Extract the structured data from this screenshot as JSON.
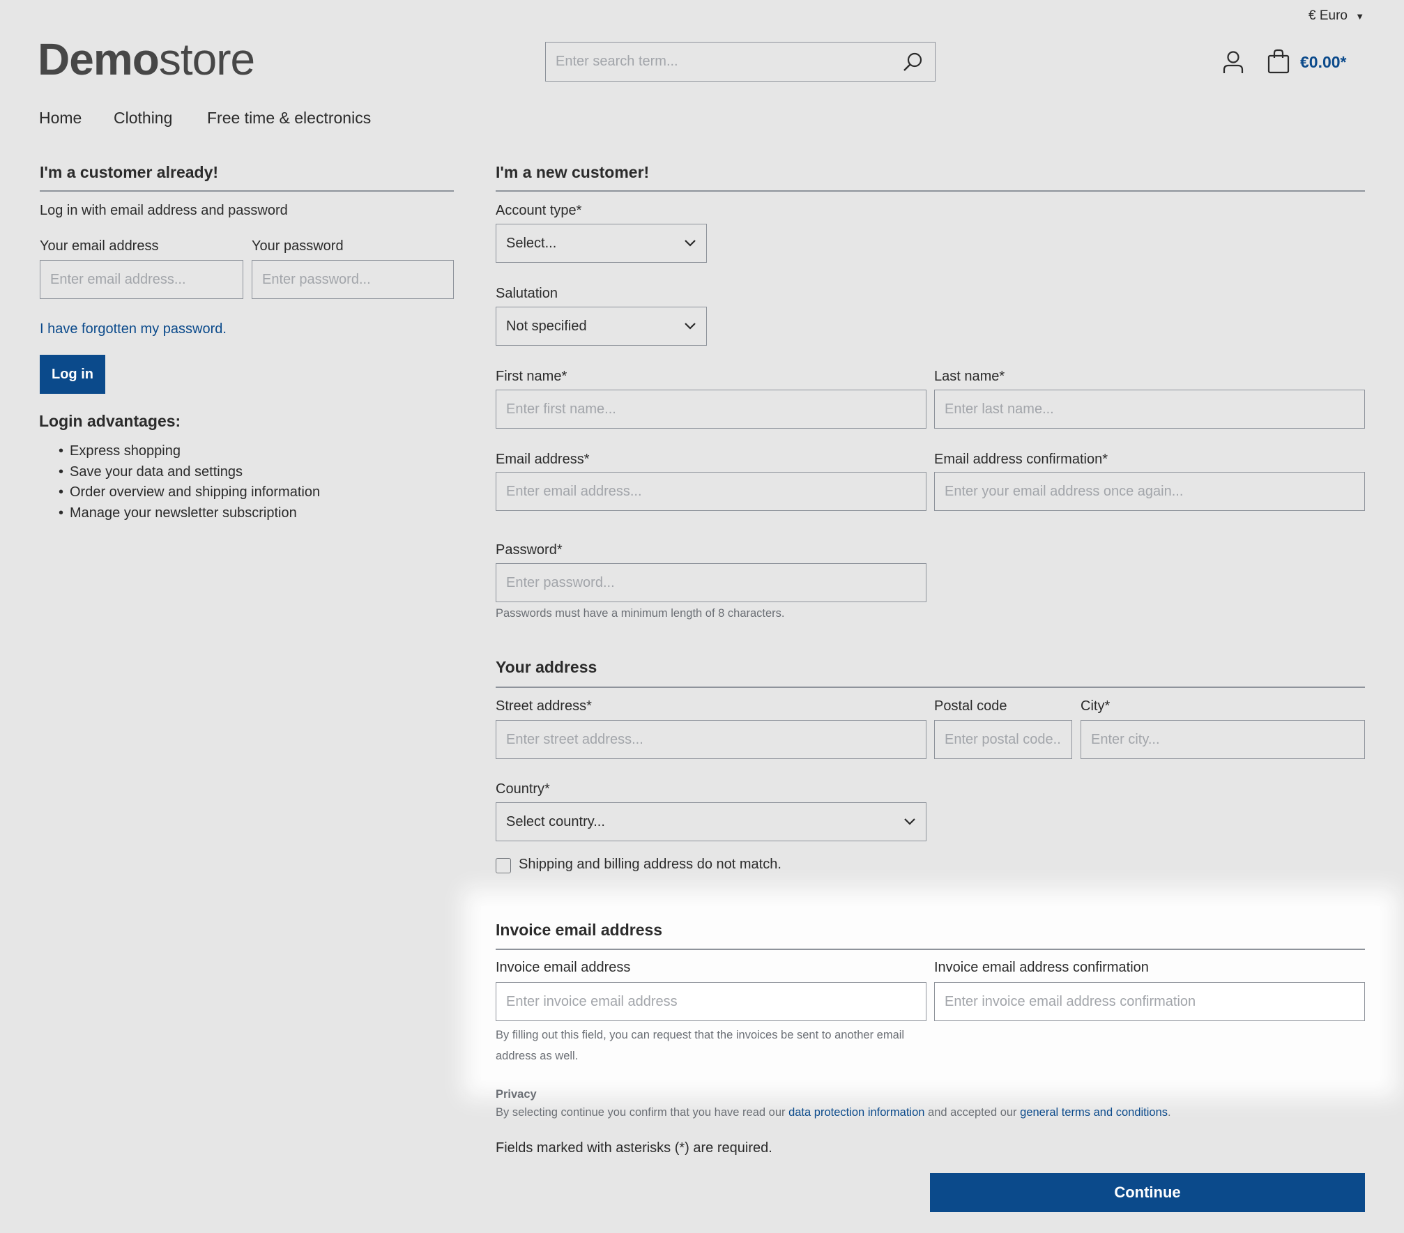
{
  "header": {
    "currency": "€ Euro",
    "logo_bold": "Demo",
    "logo_light": "store",
    "search_placeholder": "Enter search term...",
    "cart_total": "€0.00*",
    "icons": {
      "search": "search-icon",
      "account": "user-icon",
      "cart": "shopping-bag-icon"
    }
  },
  "nav": [
    "Home",
    "Clothing",
    "Free time & electronics"
  ],
  "login": {
    "title": "I'm a customer already!",
    "intro": "Log in with email address and password",
    "email_label": "Your email address",
    "email_placeholder": "Enter email address...",
    "password_label": "Your password",
    "password_placeholder": "Enter password...",
    "forgot": "I have forgotten my password.",
    "button": "Log in",
    "advantages_title": "Login advantages:",
    "advantages": [
      "Express shopping",
      "Save your data and settings",
      "Order overview and shipping information",
      "Manage your newsletter subscription"
    ]
  },
  "register": {
    "title": "I'm a new customer!",
    "account_type_label": "Account type*",
    "account_type_value": "Select...",
    "salutation_label": "Salutation",
    "salutation_value": "Not specified",
    "first_name_label": "First name*",
    "first_name_placeholder": "Enter first name...",
    "last_name_label": "Last name*",
    "last_name_placeholder": "Enter last name...",
    "email_label": "Email address*",
    "email_placeholder": "Enter email address...",
    "email_confirm_label": "Email address confirmation*",
    "email_confirm_placeholder": "Enter your email address once again...",
    "password_label": "Password*",
    "password_placeholder": "Enter password...",
    "password_hint": "Passwords must have a minimum length of 8 characters."
  },
  "address": {
    "title": "Your address",
    "street_label": "Street address*",
    "street_placeholder": "Enter street address...",
    "postal_label": "Postal code",
    "postal_placeholder": "Enter postal code...",
    "city_label": "City*",
    "city_placeholder": "Enter city...",
    "country_label": "Country*",
    "country_value": "Select country...",
    "different_shipping": "Shipping and billing address do not match.",
    "different_shipping_checked": false
  },
  "invoice": {
    "title": "Invoice email address",
    "email_label": "Invoice email address",
    "email_placeholder": "Enter invoice email address",
    "confirm_label": "Invoice email address confirmation",
    "confirm_placeholder": "Enter invoice email address confirmation",
    "hint": "By filling out this field, you can request that the invoices be sent to another email address as well."
  },
  "privacy": {
    "title": "Privacy",
    "text_1": "By selecting continue you confirm that you have read our ",
    "link_1": "data protection information",
    "text_2": " and accepted our ",
    "link_2": "general terms and conditions",
    "text_3": "."
  },
  "required_note": "Fields marked with asterisks (*) are required.",
  "continue": "Continue",
  "colors": {
    "accent": "#0b4a8b",
    "background": "#e6e6e6"
  }
}
